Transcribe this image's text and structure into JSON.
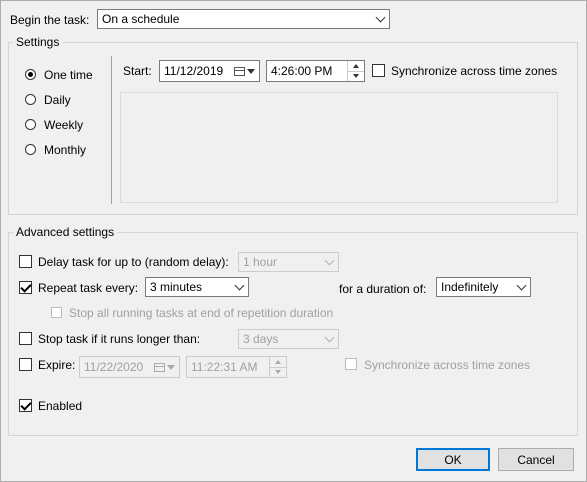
{
  "begin_task": {
    "label": "Begin the task:",
    "value": "On a schedule"
  },
  "settings": {
    "title": "Settings",
    "options": [
      {
        "label": "One time",
        "selected": true
      },
      {
        "label": "Daily",
        "selected": false
      },
      {
        "label": "Weekly",
        "selected": false
      },
      {
        "label": "Monthly",
        "selected": false
      }
    ],
    "start_label": "Start:",
    "start_date": "11/12/2019",
    "start_time": "4:26:00 PM",
    "sync_label": "Synchronize across time zones"
  },
  "advanced": {
    "title": "Advanced settings",
    "delay": {
      "label": "Delay task for up to (random delay):",
      "value": "1 hour",
      "checked": false
    },
    "repeat": {
      "label": "Repeat task every:",
      "value": "3 minutes",
      "checked": true,
      "duration_label": "for a duration of:",
      "duration_value": "Indefinitely"
    },
    "stop_running": {
      "label": "Stop all running tasks at end of repetition duration",
      "checked": false
    },
    "stop_longer": {
      "label": "Stop task if it runs longer than:",
      "value": "3 days",
      "checked": false
    },
    "expire": {
      "label": "Expire:",
      "date": "11/22/2020",
      "time": "11:22:31 AM",
      "sync_label": "Synchronize across time zones",
      "checked": false
    },
    "enabled": {
      "label": "Enabled",
      "checked": true
    }
  },
  "buttons": {
    "ok": "OK",
    "cancel": "Cancel"
  }
}
